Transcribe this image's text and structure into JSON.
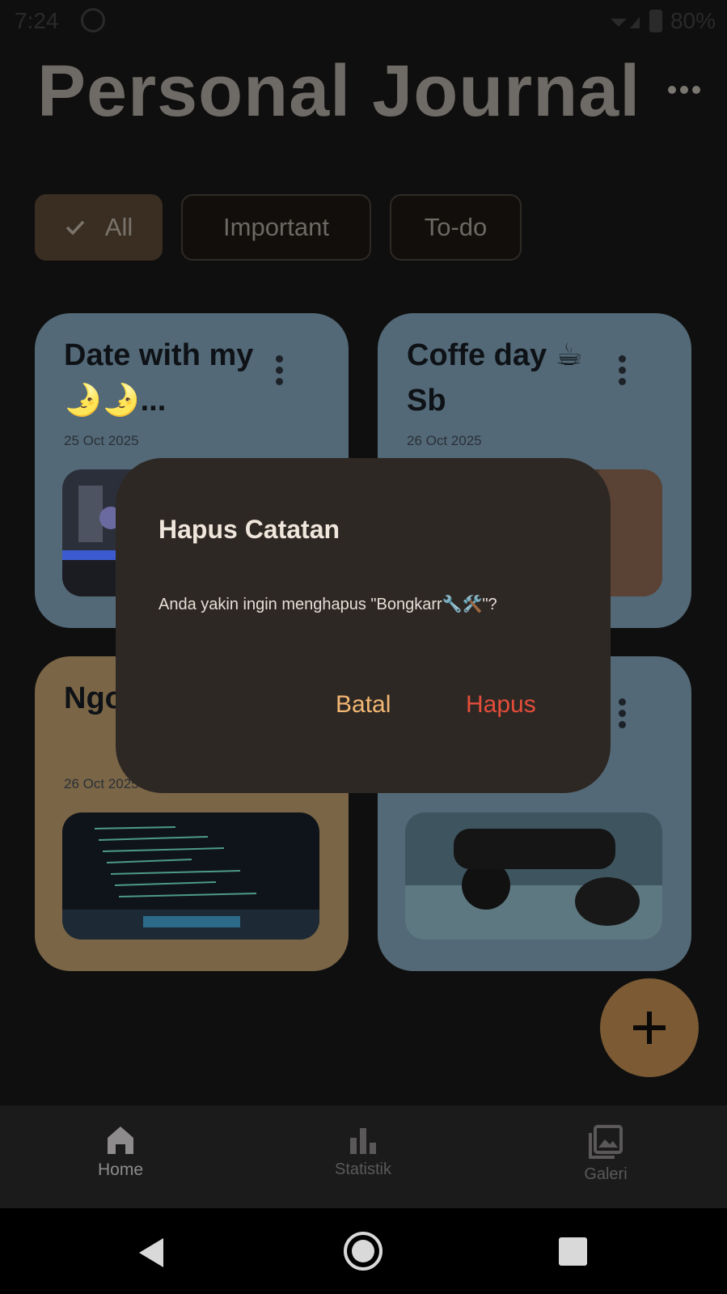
{
  "status_bar": {
    "time": "7:24",
    "battery_percent": "80%"
  },
  "header": {
    "title": "Personal Journal",
    "more_icon": "more-horizontal-icon"
  },
  "filters": {
    "all_label": "All",
    "important_label": "Important",
    "todo_label": "To-do",
    "selected": "All"
  },
  "notes": [
    {
      "title": "Date with my 🌛🌛...",
      "date": "25 Oct 2025",
      "color": "#536977"
    },
    {
      "title": "Coffe day ☕ Sb",
      "date": "26 Oct 2025",
      "color": "#536977"
    },
    {
      "title": "Ngo day",
      "date": "26 Oct 2025",
      "color": "#7a6546"
    },
    {
      "title": "",
      "date": "",
      "color": "#536977"
    }
  ],
  "dialog": {
    "title": "Hapus Catatan",
    "message": "Anda yakin ingin menghapus \"Bongkarr🔧🛠️\"?",
    "cancel_label": "Batal",
    "confirm_label": "Hapus",
    "cancel_color": "#f2b773",
    "confirm_color": "#e44d3a"
  },
  "fab": {
    "icon": "plus-icon"
  },
  "bottom_nav": {
    "items": [
      {
        "label": "Home",
        "icon": "home-icon"
      },
      {
        "label": "Statistik",
        "icon": "bar-chart-icon"
      },
      {
        "label": "Galeri",
        "icon": "gallery-icon"
      }
    ],
    "active": "Home"
  }
}
